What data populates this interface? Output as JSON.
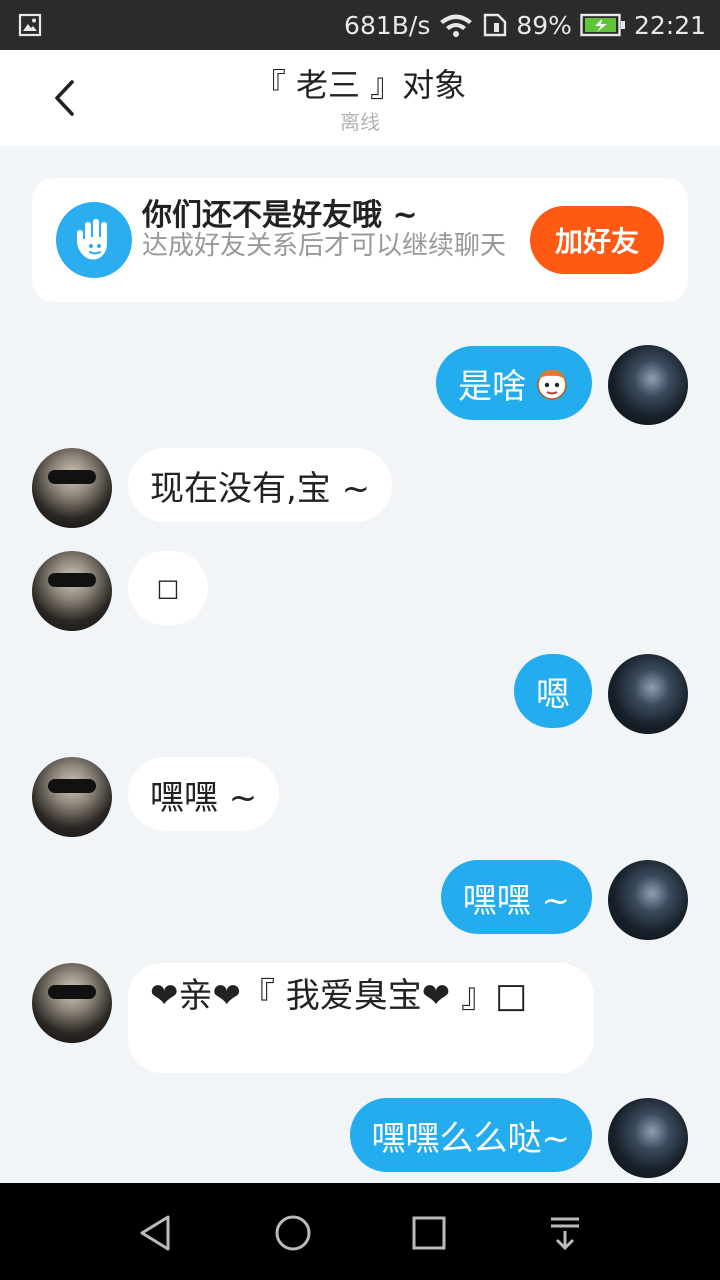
{
  "status_bar": {
    "net_speed": "681B/s",
    "battery": "89%",
    "time": "22:21"
  },
  "header": {
    "title": "『 老三 』对象",
    "subtitle": "离线"
  },
  "notice": {
    "title": "你们还不是好友哦 ~",
    "description": "达成好友关系后才可以继续聊天",
    "button": "加好友"
  },
  "messages": [
    {
      "side": "out",
      "text": "是啥"
    },
    {
      "side": "in",
      "text": "现在没有,宝 ~"
    },
    {
      "side": "in",
      "text": "□"
    },
    {
      "side": "out",
      "text": "嗯"
    },
    {
      "side": "in",
      "text": "嘿嘿 ~"
    },
    {
      "side": "out",
      "text": "嘿嘿 ~"
    },
    {
      "side": "in",
      "text": "❤亲❤『 我爱臭宝❤ 』□"
    },
    {
      "side": "out",
      "text": "嘿嘿么么哒~"
    }
  ],
  "colors": {
    "accent": "#23adee",
    "add_button": "#ff5a14",
    "background": "#f2f5f7"
  },
  "icons": [
    "image-icon",
    "wifi-icon",
    "sim-icon",
    "battery-icon",
    "back-icon",
    "hand-icon",
    "back-triangle-icon",
    "home-circle-icon",
    "recents-square-icon",
    "notification-pull-icon"
  ]
}
